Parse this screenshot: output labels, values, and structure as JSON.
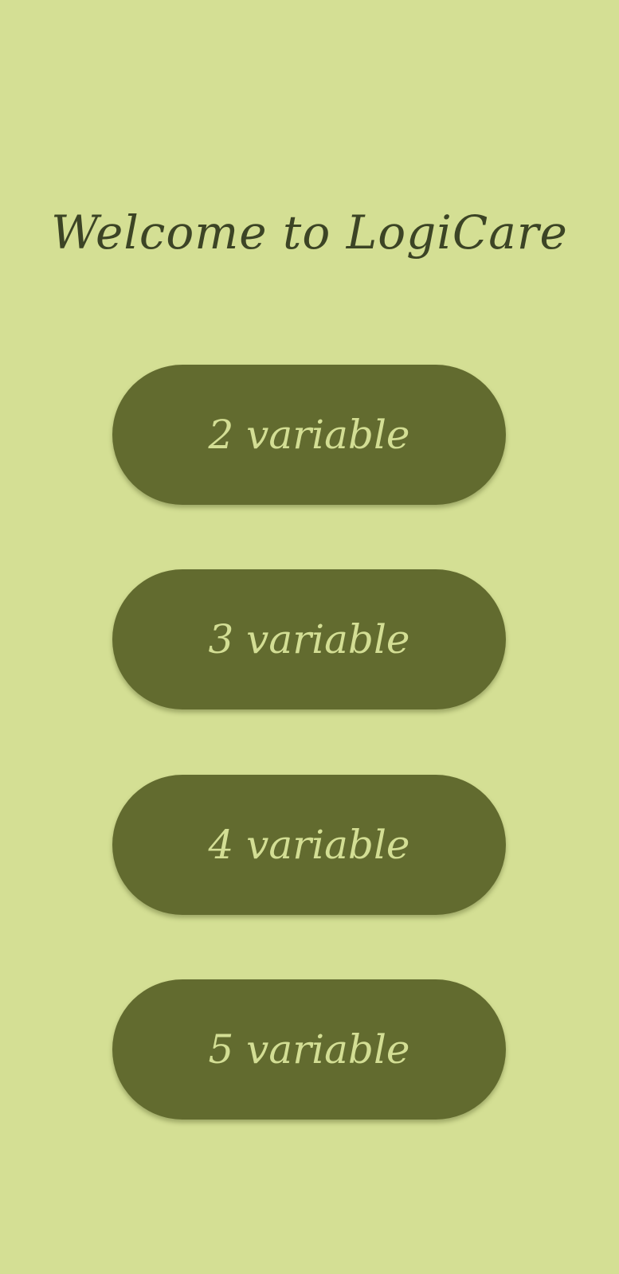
{
  "header": {
    "title": "Welcome to LogiCare"
  },
  "buttons": [
    {
      "label": "2 variable"
    },
    {
      "label": "3 variable"
    },
    {
      "label": "4 variable"
    },
    {
      "label": "5 variable"
    }
  ],
  "colors": {
    "background": "#d4df94",
    "button": "#626b2f",
    "button_text": "#d3de94",
    "title": "#3c4425"
  }
}
